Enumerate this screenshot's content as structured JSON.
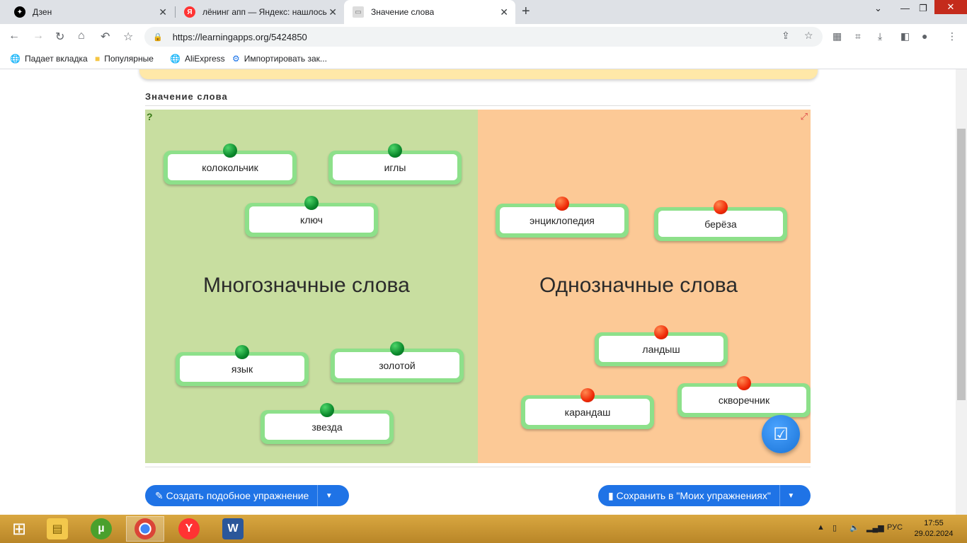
{
  "browser": {
    "tabs": [
      {
        "title": "Дзен",
        "active": false,
        "icon": "dzen-icon"
      },
      {
        "title": "лёнинг апп — Яндекс: нашлось",
        "active": false,
        "icon": "yandex-icon"
      },
      {
        "title": "Значение слова",
        "active": true,
        "icon": "page-icon"
      }
    ],
    "url": "https://learningapps.org/5424850",
    "bookmarks": [
      {
        "label": "Падает вкладка",
        "icon": "globe-icon"
      },
      {
        "label": "Популярные",
        "icon": "folder-icon"
      },
      {
        "label": "AliExpress",
        "icon": "globe-icon"
      },
      {
        "label": "Импортировать зак...",
        "icon": "gear-icon"
      }
    ]
  },
  "page": {
    "exercise_title": "Значение слова",
    "zones": {
      "left_title": "Многозначные слова",
      "right_title": "Однозначные слова"
    },
    "cards_left": [
      "колокольчик",
      "иглы",
      "ключ",
      "язык",
      "золотой",
      "звезда"
    ],
    "cards_right": [
      "энциклопедия",
      "берёза",
      "ландыш",
      "карандаш",
      "скворечник"
    ],
    "buttons": {
      "create_similar": "Создать подобное упражнение",
      "save_to_mine": "Сохранить в \"Моих упражнениях\""
    }
  },
  "taskbar": {
    "language": "РУС",
    "time": "17:55",
    "date": "29.02.2024"
  },
  "colors": {
    "left_zone": "#c8dea0",
    "right_zone": "#fcc996",
    "card_border": "#8de08a",
    "pin_green": "#0b8a2c",
    "pin_red": "#f02a08",
    "button_blue": "#1f73e6"
  }
}
